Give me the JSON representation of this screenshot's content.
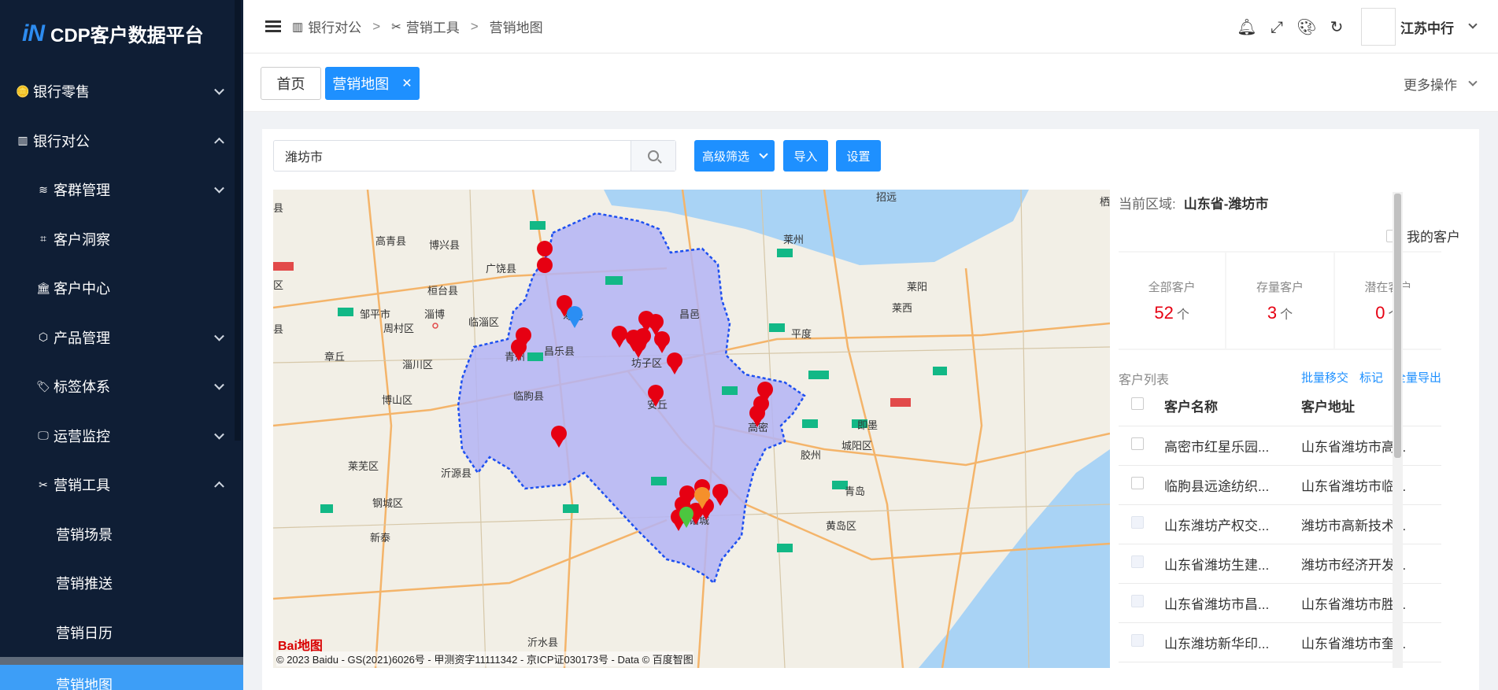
{
  "app": {
    "logo_mark": "iN",
    "title": "CDP客户数据平台"
  },
  "sidebar": {
    "items": [
      {
        "label": "银行零售",
        "icon": "coins-icon",
        "level": 1,
        "state": "collapsed"
      },
      {
        "label": "银行对公",
        "icon": "building-icon",
        "level": 1,
        "state": "expanded"
      },
      {
        "label": "客群管理",
        "icon": "layers-icon",
        "level": 2,
        "state": "collapsed"
      },
      {
        "label": "客户洞察",
        "icon": "insight-icon",
        "level": 2,
        "state": "none"
      },
      {
        "label": "客户中心",
        "icon": "bank-icon",
        "level": 2,
        "state": "none"
      },
      {
        "label": "产品管理",
        "icon": "cube-icon",
        "level": 2,
        "state": "collapsed"
      },
      {
        "label": "标签体系",
        "icon": "tags-icon",
        "level": 2,
        "state": "collapsed"
      },
      {
        "label": "运营监控",
        "icon": "monitor-icon",
        "level": 2,
        "state": "collapsed"
      },
      {
        "label": "营销工具",
        "icon": "tools-icon",
        "level": 2,
        "state": "expanded"
      },
      {
        "label": "营销场景",
        "level": 3
      },
      {
        "label": "营销推送",
        "level": 3
      },
      {
        "label": "营销日历",
        "level": 3
      },
      {
        "label": "营销地图",
        "level": 3,
        "active": true
      }
    ]
  },
  "breadcrumb": {
    "items": [
      "银行对公",
      "营销工具",
      "营销地图"
    ],
    "separator": ">"
  },
  "header": {
    "user": "江苏中行"
  },
  "tabs": {
    "items": [
      "首页",
      "营销地图"
    ],
    "active": "营销地图",
    "more": "更多操作"
  },
  "toolbar": {
    "search_value": "潍坊市",
    "filter_label": "高级筛选",
    "import_label": "导入",
    "settings_label": "设置"
  },
  "map": {
    "labels": {
      "gaoqing": "高青县",
      "boxing": "博兴县",
      "guangrao": "广饶县",
      "huantai": "桓台县",
      "zouping": "邹平市",
      "zhoucun": "周村区",
      "zibo": "淄博",
      "linzi": "临淄区",
      "zhangqiu": "章丘",
      "zichuan": "淄川区",
      "boshan": "博山区",
      "laiwu": "莱芜区",
      "yiyuan": "沂源县",
      "gangcheng": "钢城区",
      "xintai": "新泰",
      "yishui": "沂水县",
      "qingzhou": "青州",
      "shouguang": "寿光",
      "changle": "昌乐县",
      "fangzi": "坊子区",
      "changyi": "昌邑",
      "linqu": "临朐县",
      "anqiu": "安丘",
      "gaomi": "高密",
      "zhucheng": "诸城",
      "laizhou": "莱州",
      "pingdu": "平度",
      "laiyang": "莱阳",
      "laixi": "莱西",
      "zhaoyuan": "招远",
      "jimo": "即墨",
      "chengyang": "城阳区",
      "jiaozhou": "胶州",
      "qingdao": "青岛",
      "huangdao": "黄岛区",
      "qu": "区",
      "xian": "县",
      "xi": "栖"
    },
    "baidu_logo": "Bai地图",
    "copyright": "© 2023 Baidu - GS(2021)6026号 - 甲测资字11111342 - 京ICP证030173号 - Data © 百度智图"
  },
  "panel": {
    "region_label": "当前区域:",
    "region_value": "山东省-潍坊市",
    "my_customers": "我的客户",
    "stats": [
      {
        "label": "全部客户",
        "value": "52",
        "unit": "个"
      },
      {
        "label": "存量客户",
        "value": "3",
        "unit": "个"
      },
      {
        "label": "潜在客户",
        "value": "0",
        "unit": "个"
      }
    ],
    "list_title": "客户列表",
    "actions": [
      "批量移交",
      "标记",
      "全量导出"
    ],
    "columns": [
      "客户名称",
      "客户地址"
    ],
    "rows": [
      {
        "name": "高密市红星乐园...",
        "addr": "山东省潍坊市高..."
      },
      {
        "name": "临朐县远途纺织...",
        "addr": "山东省潍坊市临..."
      },
      {
        "name": "山东潍坊产权交...",
        "addr": "潍坊市高新技术..."
      },
      {
        "name": "山东省潍坊生建...",
        "addr": "潍坊市经济开发..."
      },
      {
        "name": "山东省潍坊市昌...",
        "addr": "山东省潍坊市胜..."
      },
      {
        "name": "山东潍坊新华印...",
        "addr": "山东省潍坊市奎..."
      }
    ]
  },
  "colors": {
    "sidebar_bg": "#0f1e35",
    "accent": "#1e90ff",
    "region_fill": "#b4b4f4",
    "marker_red": "#e60012",
    "stat_value": "#e60012"
  }
}
